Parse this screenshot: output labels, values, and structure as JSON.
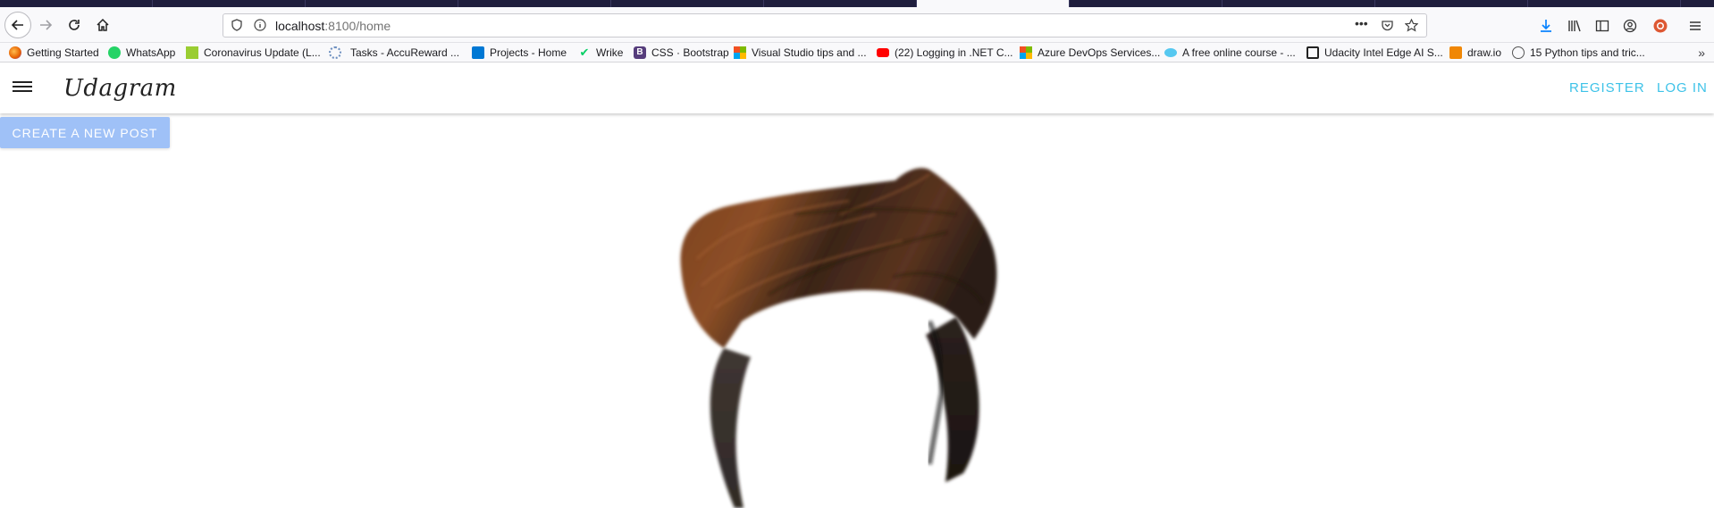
{
  "browser": {
    "url_host": "localhost",
    "url_rest": ":8100/home",
    "bookmarks": [
      {
        "label": "Getting Started",
        "icon": "firefox-icon",
        "color": "#e66000"
      },
      {
        "label": "WhatsApp",
        "icon": "whatsapp-icon",
        "color": "#25d366"
      },
      {
        "label": "Coronavirus Update (L...",
        "icon": "coronavirus-update-icon",
        "color": "#9acd32"
      },
      {
        "label": "Tasks - AccuReward ...",
        "icon": "accureward-icon",
        "color": "#6c8ebf"
      },
      {
        "label": "Projects - Home",
        "icon": "azure-devops-icon",
        "color": "#0078d4"
      },
      {
        "label": "Wrike",
        "icon": "wrike-check-icon",
        "color": "#08cf65"
      },
      {
        "label": "CSS · Bootstrap",
        "icon": "bootstrap-icon",
        "color": "#563d7c"
      },
      {
        "label": "Visual Studio tips and ...",
        "icon": "microsoft-icon",
        "color": "#f25022"
      },
      {
        "label": "(22) Logging in .NET C...",
        "icon": "youtube-icon",
        "color": "#ff0000"
      },
      {
        "label": "Azure DevOps Services...",
        "icon": "microsoft-icon",
        "color": "#7fba00"
      },
      {
        "label": "A free online course - ...",
        "icon": "cloud-icon",
        "color": "#56c8f0"
      },
      {
        "label": "Udacity Intel Edge AI S...",
        "icon": "trello-icon",
        "color": "#222222"
      },
      {
        "label": "draw.io",
        "icon": "drawio-icon",
        "color": "#f08705"
      },
      {
        "label": "15 Python tips and tric...",
        "icon": "globe-icon",
        "color": "#555555"
      }
    ]
  },
  "app": {
    "logo": "Udagram",
    "register_label": "REGISTER",
    "login_label": "LOG IN",
    "create_post_label": "CREATE A NEW POST",
    "accent_color": "#3dc2e8",
    "button_color": "#9fc1f7"
  }
}
